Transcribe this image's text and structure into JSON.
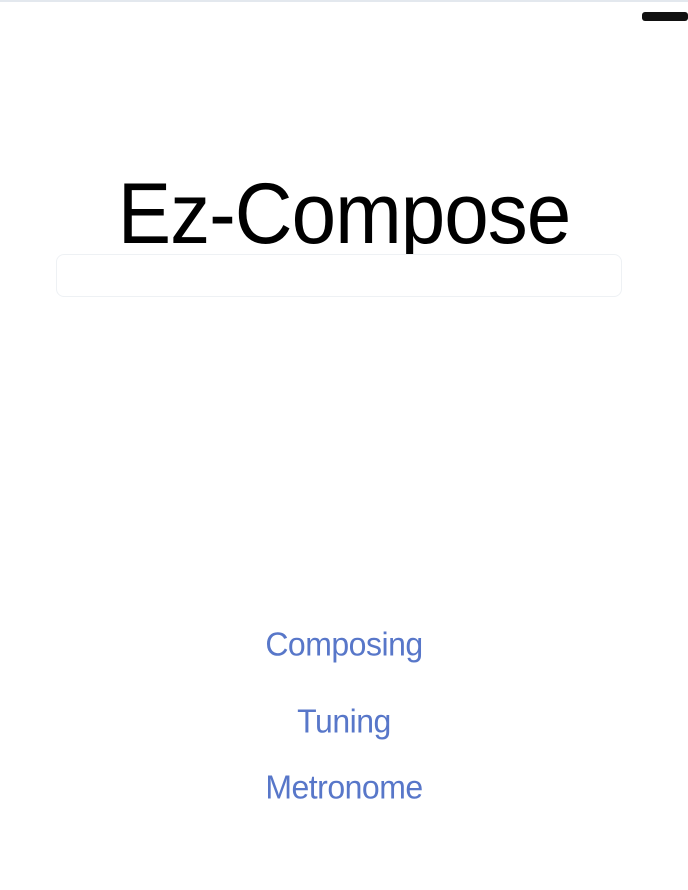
{
  "app": {
    "title": "Ez-Compose"
  },
  "search": {
    "value": ""
  },
  "menu": {
    "items": [
      {
        "label": "Composing"
      },
      {
        "label": "Tuning"
      },
      {
        "label": "Metronome"
      }
    ]
  },
  "colors": {
    "accent": "#5877c9",
    "title": "#000000",
    "background": "#ffffff"
  },
  "icons": {
    "status": "battery-icon"
  }
}
